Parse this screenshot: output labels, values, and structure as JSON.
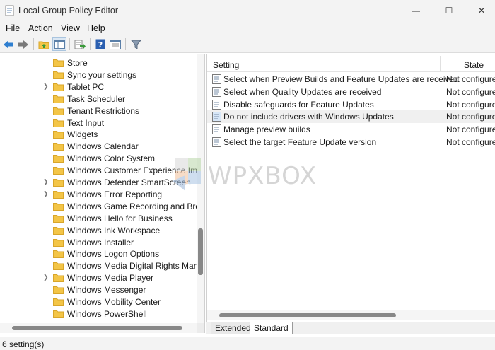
{
  "window": {
    "title": "Local Group Policy Editor",
    "minimize_glyph": "—",
    "maximize_glyph": "☐",
    "close_glyph": "✕"
  },
  "menu": [
    "File",
    "Action",
    "View",
    "Help"
  ],
  "toolbar": {
    "icons": [
      "back-arrow-icon",
      "forward-arrow-icon",
      "up-folder-icon",
      "show-hide-tree-icon",
      "export-list-icon",
      "help-icon",
      "properties-icon",
      "filter-icon"
    ]
  },
  "tree": {
    "items": [
      {
        "label": "Store",
        "expandable": false
      },
      {
        "label": "Sync your settings",
        "expandable": false
      },
      {
        "label": "Tablet PC",
        "expandable": true
      },
      {
        "label": "Task Scheduler",
        "expandable": false
      },
      {
        "label": "Tenant Restrictions",
        "expandable": false
      },
      {
        "label": "Text Input",
        "expandable": false
      },
      {
        "label": "Widgets",
        "expandable": false
      },
      {
        "label": "Windows Calendar",
        "expandable": false
      },
      {
        "label": "Windows Color System",
        "expandable": false
      },
      {
        "label": "Windows Customer Experience Impro",
        "expandable": false
      },
      {
        "label": "Windows Defender SmartScreen",
        "expandable": true
      },
      {
        "label": "Windows Error Reporting",
        "expandable": true
      },
      {
        "label": "Windows Game Recording and Broac",
        "expandable": false
      },
      {
        "label": "Windows Hello for Business",
        "expandable": false
      },
      {
        "label": "Windows Ink Workspace",
        "expandable": false
      },
      {
        "label": "Windows Installer",
        "expandable": false
      },
      {
        "label": "Windows Logon Options",
        "expandable": false
      },
      {
        "label": "Windows Media Digital Rights Mana",
        "expandable": false
      },
      {
        "label": "Windows Media Player",
        "expandable": true
      },
      {
        "label": "Windows Messenger",
        "expandable": false
      },
      {
        "label": "Windows Mobility Center",
        "expandable": false
      },
      {
        "label": "Windows PowerShell",
        "expandable": false
      }
    ]
  },
  "list": {
    "columns": {
      "setting": "Setting",
      "state": "State"
    },
    "rows": [
      {
        "name": "Select when Preview Builds and Feature Updates are received",
        "state": "Not configured",
        "selected": false
      },
      {
        "name": "Select when Quality Updates are received",
        "state": "Not configured",
        "selected": false
      },
      {
        "name": "Disable safeguards for Feature Updates",
        "state": "Not configured",
        "selected": false
      },
      {
        "name": "Do not include drivers with Windows Updates",
        "state": "Not configured",
        "selected": true
      },
      {
        "name": "Manage preview builds",
        "state": "Not configured",
        "selected": false
      },
      {
        "name": "Select the target Feature Update version",
        "state": "Not configured",
        "selected": false
      }
    ]
  },
  "watermark": {
    "text": "WPXBOX"
  },
  "tabs": [
    {
      "label": "Extended",
      "active": false
    },
    {
      "label": "Standard",
      "active": true
    }
  ],
  "status": {
    "text": "6 setting(s)"
  },
  "colors": {
    "folder": "#f3c547",
    "folder_dark": "#d9a62a",
    "nav_arrow": "#2f7fd0",
    "help_blue": "#2a5fb0"
  }
}
